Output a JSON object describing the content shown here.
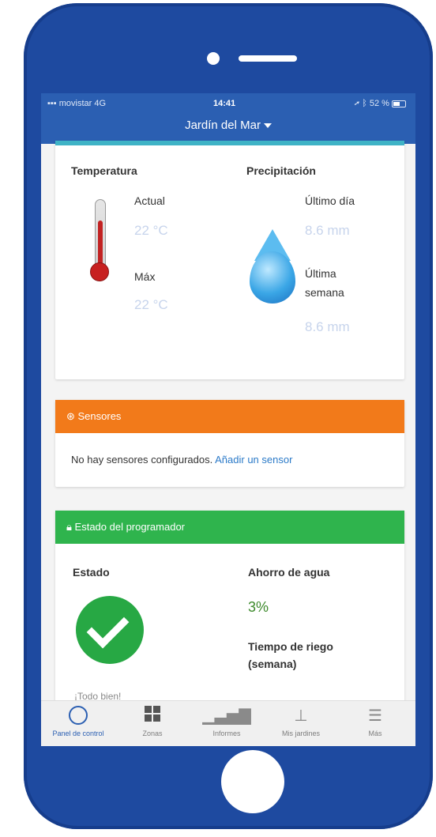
{
  "statusbar": {
    "carrier": "movistar",
    "network": "4G",
    "time": "14:41",
    "battery": "52 %"
  },
  "header": {
    "title": "Jardín del Mar"
  },
  "weather": {
    "temperature_label": "Temperatura",
    "actual_label": "Actual",
    "actual_value": "22 °C",
    "max_label": "Máx",
    "max_value": "22 °C",
    "precip_label": "Precipitación",
    "last_day_label": "Último día",
    "last_day_value": "8.6 mm",
    "last_week_label_1": "Última",
    "last_week_label_2": "semana",
    "last_week_value": "8.6 mm"
  },
  "sensors": {
    "title": "Sensores",
    "message": "No hay sensores configurados.",
    "add_link": "Añadir un sensor"
  },
  "programmer": {
    "title": "Estado del programador",
    "status_label": "Estado",
    "status_text": "¡Todo bien!",
    "savings_label": "Ahorro de agua",
    "savings_value": "3%",
    "irrigation_label_1": "Tiempo de riego",
    "irrigation_label_2": "(semana)"
  },
  "tabs": [
    {
      "label": "Panel de control",
      "icon": "dashboard-icon"
    },
    {
      "label": "Zonas",
      "icon": "zones-icon"
    },
    {
      "label": "Informes",
      "icon": "reports-icon"
    },
    {
      "label": "Mis jardines",
      "icon": "gardens-icon"
    },
    {
      "label": "Más",
      "icon": "menu-icon"
    }
  ],
  "colors": {
    "phone_frame": "#1e4aa0",
    "navbar": "#2b5fb2",
    "sensors_header": "#f27a1a",
    "status_header": "#2fb44d",
    "accent_teal": "#3fb3c6"
  }
}
